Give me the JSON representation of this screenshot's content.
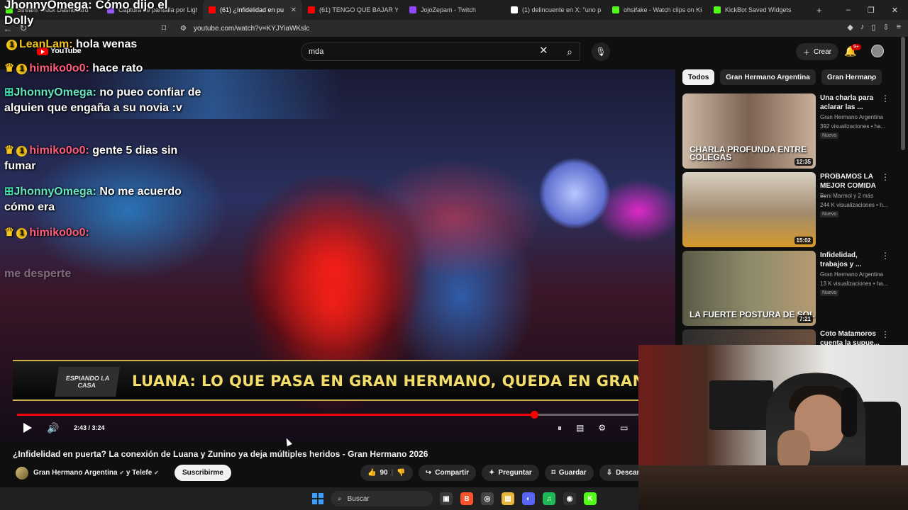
{
  "browser": {
    "tabs": [
      {
        "label": "Stream - Kick Dashboard",
        "color": "#53fc18"
      },
      {
        "label": "Captura de pantalla por Lightshot",
        "color": "#9b59ff"
      },
      {
        "label": "(61) ¿Infidelidad en puerta",
        "color": "#ff0000",
        "active": true
      },
      {
        "label": "(61) TENGO QUE BAJAR YO A",
        "color": "#ff0000"
      },
      {
        "label": "JojoZepam - Twitch",
        "color": "#9146ff"
      },
      {
        "label": "(1) delincuente en X: \"uno pu",
        "color": "#ffffff"
      },
      {
        "label": "ohsifake - Watch clips on Kick",
        "color": "#53fc18"
      },
      {
        "label": "KickBot Saved Widgets",
        "color": "#53fc18"
      }
    ],
    "new_tab": "+",
    "url": "youtube.com/watch?v=KYJYiaWKslc",
    "window_controls": [
      "–",
      "❐",
      "✕"
    ]
  },
  "youtube": {
    "search_value": "mda",
    "create_label": "Crear",
    "notif_count": "9+",
    "logo_text": "YouTube"
  },
  "overlay": {
    "top_user": "JhonnyOmega:",
    "top_text": "Cómo dijo el Dolly",
    "messages": [
      {
        "user": "LeanLam:",
        "text": "hola wenas",
        "user_color": "#f5c518",
        "badges": "badge"
      },
      {
        "user": "himiko0o0:",
        "text": "hace rato",
        "user_color": "#ff5b7a",
        "badges": "crown"
      },
      {
        "user": "JhonnyOmega:",
        "text": "no pueo confiar de alguien que engaña a su novia :v",
        "user_color": "#66e6c0",
        "badges": "pb"
      },
      {
        "user": "himiko0o0:",
        "text": "gente 5 dias sin fumar",
        "user_color": "#ff5b7a",
        "badges": "crown"
      },
      {
        "user": "JhonnyOmega:",
        "text": "No me acuerdo cómo era",
        "user_color": "#66e6c0",
        "badges": "pb"
      },
      {
        "user": "himiko0o0:",
        "text": "",
        "user_color": "#ff5b7a",
        "badges": "crown"
      }
    ],
    "faded_text": "me desperte"
  },
  "player": {
    "chyron_logo": "ESPIANDO LA CASA",
    "chyron_text": "LUANA: LO QUE PASA EN GRAN HERMANO, QUEDA EN GRAN HERMANO",
    "time": "2:43 / 3:24",
    "progress": 0.83
  },
  "video": {
    "title": "¿Infidelidad en puerta? La conexión de Luana y Zunino ya deja múltiples heridos - Gran Hermano 2026",
    "channel": "Gran Hermano Argentina",
    "channel_suffix": "y Telefe",
    "subscribe": "Suscribirme",
    "likes": "90",
    "share": "Compartir",
    "ask": "Preguntar",
    "save": "Guardar",
    "download": "Descar"
  },
  "sidebar": {
    "chips": [
      "Todos",
      "Gran Hermano Argentina",
      "Gran Hermano"
    ],
    "recs": [
      {
        "title": "Una charla para aclarar las ...",
        "channel": "Gran Hermano Argentina",
        "views": "392 visualizaciones • ha...",
        "new": "Nuevo",
        "caption": "CHARLA PROFUNDA ENTRE COLEGAS",
        "duration": "12:35",
        "bg": "linear-gradient(90deg,#cdb9a6,#7b6252 50%,#c9b09b)"
      },
      {
        "title": "PROBAMOS LA MEJOR COMIDA ...",
        "channel": "Beni Marmol y 2 más",
        "views": "244 K visualizaciones • h...",
        "new": "Nuevo",
        "caption": "",
        "duration": "15:02",
        "bg": "linear-gradient(180deg,#d8d0c2,#a28a6d 55%,#d79a2c)"
      },
      {
        "title": "Infidelidad, trabajos y ...",
        "channel": "Gran Hermano Argentina",
        "views": "13 K visualizaciones • ha...",
        "new": "Nuevo",
        "caption": "LA FUERTE POSTURA DE SOL",
        "duration": "7:21",
        "bg": "linear-gradient(90deg,#5b5a46,#8d8a6a 50%,#b59a72)"
      },
      {
        "title": "Coto Matamoros cuenta la supue...",
        "channel": "",
        "views": "",
        "new": "",
        "caption": "",
        "duration": "",
        "bg": "linear-gradient(90deg,#2d2d2d,#6a4f3f)"
      }
    ]
  },
  "taskbar": {
    "search": "Buscar",
    "apps": [
      {
        "name": "task-view",
        "label": "▣",
        "color": "#3a3a3a"
      },
      {
        "name": "brave",
        "label": "B",
        "color": "#fb542b"
      },
      {
        "name": "chrome-alt",
        "label": "◎",
        "color": "#444"
      },
      {
        "name": "file-explorer",
        "label": "▤",
        "color": "#e8b43c"
      },
      {
        "name": "discord",
        "label": "◐",
        "color": "#5865f2"
      },
      {
        "name": "spotify",
        "label": "♫",
        "color": "#1db954"
      },
      {
        "name": "obs",
        "label": "◉",
        "color": "#302e31"
      },
      {
        "name": "kick",
        "label": "K",
        "color": "#53fc18"
      }
    ]
  }
}
